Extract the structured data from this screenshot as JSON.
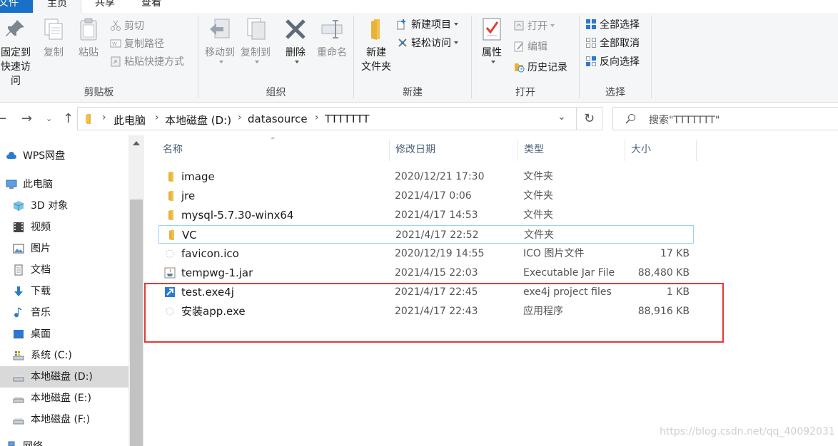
{
  "ribbon": {
    "tabs": [
      "文件",
      "主页",
      "共享",
      "查看"
    ],
    "clipboard": {
      "pin_line1": "固定到",
      "pin_line2": "快速访问",
      "copy": "复制",
      "paste": "粘贴",
      "cut": "剪切",
      "copy_path": "复制路径",
      "paste_shortcut": "粘贴快捷方式",
      "label": "剪贴板"
    },
    "organize": {
      "move_to": "移动到",
      "copy_to": "复制到",
      "delete": "删除",
      "rename": "重命名",
      "label": "组织"
    },
    "new": {
      "new_folder_line1": "新建",
      "new_folder_line2": "文件夹",
      "new_item": "新建项目",
      "easy_access": "轻松访问",
      "label": "新建"
    },
    "open": {
      "properties": "属性",
      "open": "打开",
      "edit": "编辑",
      "history": "历史记录",
      "label": "打开"
    },
    "select": {
      "select_all": "全部选择",
      "select_none": "全部取消",
      "invert": "反向选择",
      "label": "选择"
    }
  },
  "address": {
    "crumbs": [
      "此电脑",
      "本地磁盘 (D:)",
      "datasource",
      "TTTTTTT"
    ],
    "search_placeholder": "搜索\"TTTTTTT\""
  },
  "nav": {
    "items": [
      {
        "label": "WPS网盘",
        "icon": "cloud-icon"
      },
      {
        "label": "此电脑",
        "icon": "computer-icon"
      },
      {
        "label": "3D 对象",
        "icon": "cube-icon"
      },
      {
        "label": "视频",
        "icon": "video-icon"
      },
      {
        "label": "图片",
        "icon": "picture-icon"
      },
      {
        "label": "文档",
        "icon": "document-icon"
      },
      {
        "label": "下载",
        "icon": "download-icon"
      },
      {
        "label": "音乐",
        "icon": "music-icon"
      },
      {
        "label": "桌面",
        "icon": "desktop-icon"
      },
      {
        "label": "系统 (C:)",
        "icon": "system-drive-icon"
      },
      {
        "label": "本地磁盘 (D:)",
        "icon": "drive-icon"
      },
      {
        "label": "本地磁盘 (E:)",
        "icon": "drive-icon"
      },
      {
        "label": "本地磁盘 (F:)",
        "icon": "drive-icon"
      },
      {
        "label": "网络",
        "icon": "network-icon"
      }
    ]
  },
  "list": {
    "headers": {
      "name": "名称",
      "date": "修改日期",
      "type": "类型",
      "size": "大小"
    },
    "rows": [
      {
        "name": "image",
        "date": "2020/12/21 17:30",
        "type": "文件夹",
        "size": "",
        "icon": "folder-icon"
      },
      {
        "name": "jre",
        "date": "2021/4/17 0:06",
        "type": "文件夹",
        "size": "",
        "icon": "folder-icon"
      },
      {
        "name": "mysql-5.7.30-winx64",
        "date": "2021/4/17 14:53",
        "type": "文件夹",
        "size": "",
        "icon": "folder-icon"
      },
      {
        "name": "VC",
        "date": "2021/4/17 22:52",
        "type": "文件夹",
        "size": "",
        "icon": "folder-icon"
      },
      {
        "name": "favicon.ico",
        "date": "2020/12/19 14:55",
        "type": "ICO 图片文件",
        "size": "17 KB",
        "icon": "ico-file-icon"
      },
      {
        "name": "tempwg-1.jar",
        "date": "2021/4/15 22:03",
        "type": "Executable Jar File",
        "size": "88,480 KB",
        "icon": "jar-file-icon"
      },
      {
        "name": "test.exe4j",
        "date": "2021/4/17 22:45",
        "type": "exe4j project files",
        "size": "1 KB",
        "icon": "exe4j-file-icon"
      },
      {
        "name": "安装app.exe",
        "date": "2021/4/17 22:43",
        "type": "应用程序",
        "size": "88,916 KB",
        "icon": "exe-file-icon"
      }
    ]
  },
  "watermark": "https://blog.csdn.net/qq_40092031",
  "colors": {
    "accent": "#1a6fc9",
    "folder": "#e8b33a",
    "highlight_border": "#99d1ff",
    "annotation_red": "#e53935"
  }
}
